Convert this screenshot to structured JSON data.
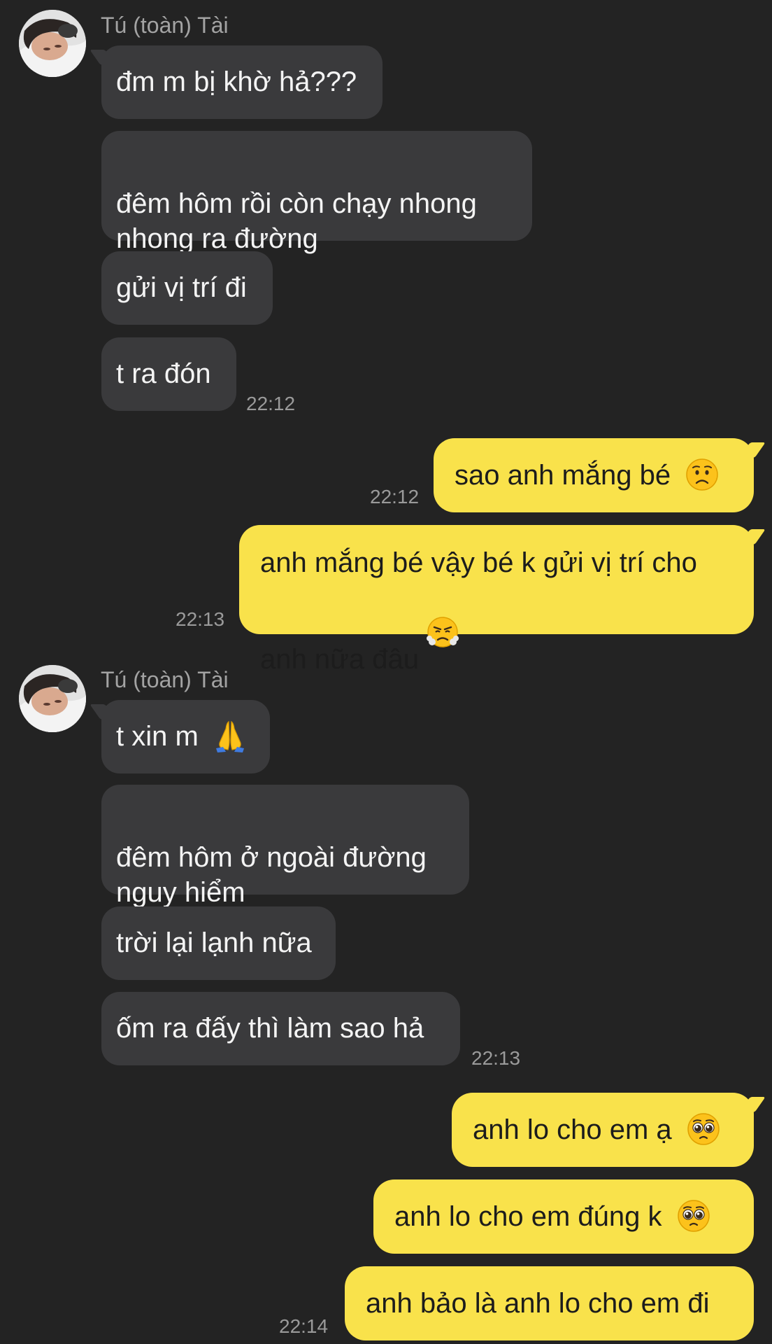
{
  "conversation": {
    "contact_name": "Tú (toàn) Tài",
    "groups": [
      {
        "sender": "Tú (toàn) Tài",
        "messages": [
          {
            "text": "đm m bị khờ hả???"
          },
          {
            "text": "đêm hôm rồi còn chạy nhong\nnhong ra đường"
          },
          {
            "text": "gửi vị trí đi"
          },
          {
            "text": "t ra đón",
            "time": "22:12"
          }
        ]
      },
      {
        "sender": "me",
        "messages": [
          {
            "text": "sao anh mắng bé",
            "emoji": "worried-face-emoji",
            "time": "22:12"
          },
          {
            "text": "anh mắng bé vậy bé k gửi vị trí cho\nanh nữa đâu",
            "emoji": "steam-from-nose-emoji",
            "time": "22:13"
          }
        ]
      },
      {
        "sender": "Tú (toàn) Tài",
        "messages": [
          {
            "text": "t xin m",
            "emoji": "folded-hands-emoji"
          },
          {
            "text": "đêm hôm ở ngoài đường\nnguy hiểm"
          },
          {
            "text": "trời lại lạnh nữa"
          },
          {
            "text": "ốm ra đấy thì làm sao hả",
            "time": "22:13"
          }
        ]
      },
      {
        "sender": "me",
        "messages": [
          {
            "text": "anh lo cho em ạ",
            "emoji": "pleading-face-emoji"
          },
          {
            "text": "anh lo cho em đúng k",
            "emoji": "pleading-face-emoji"
          },
          {
            "text": "anh bảo là anh lo cho em đi",
            "time": "22:14"
          }
        ]
      }
    ]
  },
  "theme": {
    "background": "#232323",
    "incoming_bubble": "#3a3a3c",
    "outgoing_bubble": "#f9e24b",
    "incoming_text": "#f4f4f4",
    "outgoing_text": "#1c1c1c",
    "meta_text": "#9a9a9a"
  }
}
